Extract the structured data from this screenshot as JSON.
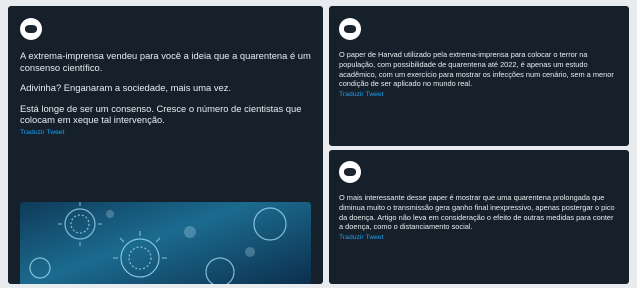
{
  "left_tweet": {
    "display_name": "",
    "handle": "",
    "paragraphs": [
      "A extrema-imprensa vendeu para você a ideia que a quarentena é um consenso científico.",
      "Adivinha? Enganaram a sociedade, mais uma vez.",
      "Está longe de ser um consenso. Cresce o número de cientistas que colocam em xeque tal intervenção."
    ],
    "translate": "Traduzir Tweet",
    "media_icon": "coronavirus-image"
  },
  "right_top_tweet": {
    "display_name": "",
    "handle": "",
    "text": "O paper de Harvad utilizado pela extrema-imprensa para colocar o terror na população, com possibilidade de quarentena até 2022, é apenas um estudo acadêmico, com um exercício para mostrar os infecções num cenário, sem a menor condição de ser aplicado no mundo real.",
    "translate": "Traduzir Tweet",
    "meta": "",
    "meta_link": ""
  },
  "right_bottom_tweet": {
    "display_name": "",
    "handle": "",
    "text": "O mais interessante desse paper é mostrar que uma quarentena prolongada que diminua muito o transmissão gera ganho final inexpressivo, apenas postergar o pico da doença. Artigo não leva em consideração o efeito de outras medidas para conter a doença, como o distanciamento social.",
    "translate": "Traduzir Tweet",
    "meta": "",
    "meta_link": ""
  },
  "colors": {
    "card_bg": "#15202b",
    "text": "#e6ecf0",
    "secondary": "#8899a6",
    "accent": "#1da1f2"
  }
}
